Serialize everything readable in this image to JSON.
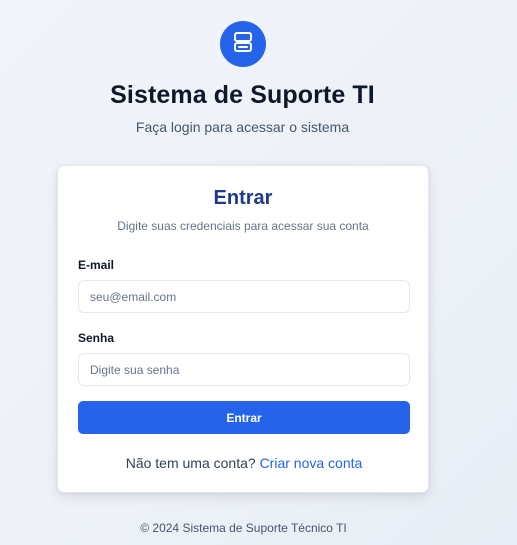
{
  "header": {
    "logo_icon": "server-icon",
    "title": "Sistema de Suporte TI",
    "subtitle": "Faça login para acessar o sistema"
  },
  "login_card": {
    "title": "Entrar",
    "subtitle": "Digite suas credenciais para acessar sua conta",
    "email": {
      "label": "E-mail",
      "value": "",
      "placeholder": "seu@email.com"
    },
    "password": {
      "label": "Senha",
      "value": "",
      "placeholder": "Digite sua senha"
    },
    "submit_label": "Entrar",
    "signup_prompt": "Não tem uma conta?",
    "signup_link": "Criar nova conta"
  },
  "footer": {
    "copyright": "© 2024 Sistema de Suporte Técnico TI"
  },
  "colors": {
    "accent": "#2563eb",
    "title": "#0f172a",
    "card_title": "#1e3a8a",
    "background": "#eef2f8"
  }
}
